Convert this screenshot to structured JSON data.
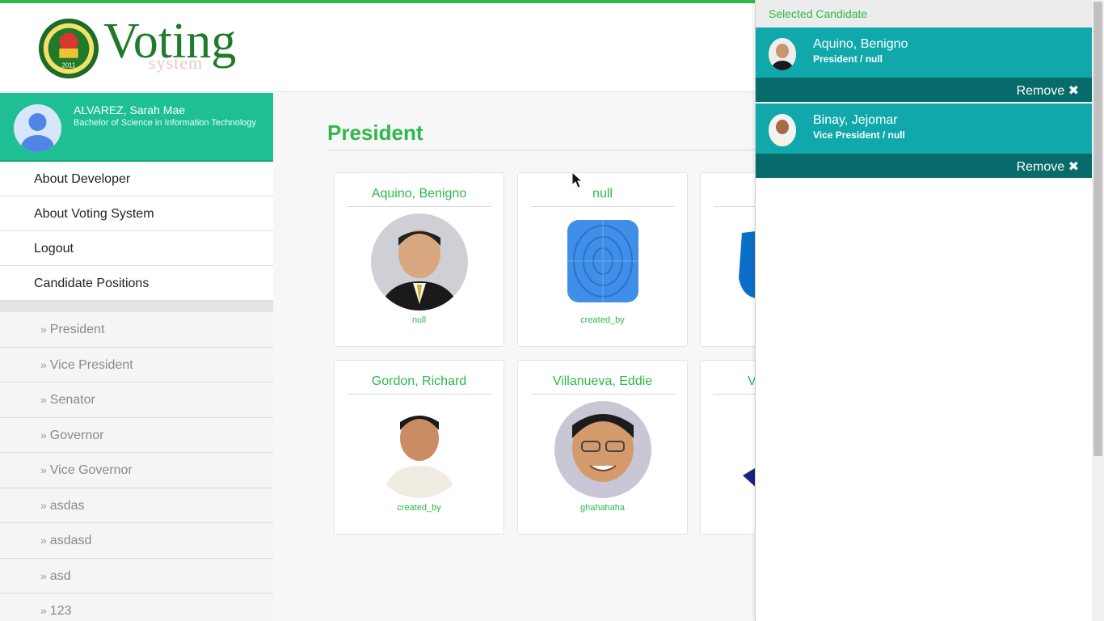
{
  "app": {
    "title": "Voting System",
    "logo_text": "Voting",
    "logo_sub": "system",
    "seal_year": "2011"
  },
  "profile": {
    "name": "ALVAREZ, Sarah Mae",
    "course": "Bachelor of Science in Information Technology"
  },
  "menu": [
    {
      "label": "About Developer"
    },
    {
      "label": "About Voting System"
    },
    {
      "label": "Logout"
    },
    {
      "label": "Candidate Positions"
    }
  ],
  "positions": [
    {
      "label": "President"
    },
    {
      "label": "Vice President"
    },
    {
      "label": "Senator"
    },
    {
      "label": "Governor"
    },
    {
      "label": "Vice Governor"
    },
    {
      "label": "asdas"
    },
    {
      "label": "asdasd"
    },
    {
      "label": "asd"
    },
    {
      "label": "123"
    }
  ],
  "page": {
    "title": "President"
  },
  "candidates": [
    {
      "name": "Aquino, Benigno",
      "party": "null"
    },
    {
      "name": "null",
      "party": "created_by"
    },
    {
      "name": "",
      "party": ""
    },
    {
      "name": "Gordon, Richard",
      "party": "created_by"
    },
    {
      "name": "Villanueva, Eddie",
      "party": "ghahahaha"
    },
    {
      "name": "V",
      "party": ""
    }
  ],
  "selected_panel": {
    "header": "Selected Candidate",
    "remove_label": "Remove",
    "items": [
      {
        "name": "Aquino, Benigno",
        "position": "President / null"
      },
      {
        "name": "Binay, Jejomar",
        "position": "Vice President / null"
      }
    ]
  },
  "colors": {
    "accent": "#2eb84a",
    "profile_bg": "#1fbf94",
    "selected_bg": "#10a8aa",
    "selected_footer": "#076a6b"
  }
}
